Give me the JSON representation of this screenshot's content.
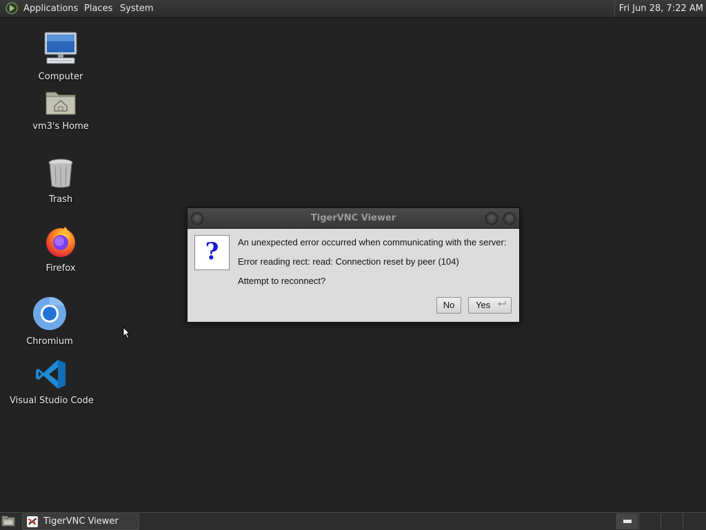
{
  "top_panel": {
    "menus": [
      "Applications",
      "Places",
      "System"
    ],
    "clock": "Fri Jun 28,  7:22 AM"
  },
  "desktop_icons": [
    {
      "label": "Computer",
      "icon": "computer-icon"
    },
    {
      "label": "vm3's Home",
      "icon": "home-folder-icon"
    },
    {
      "label": "Trash",
      "icon": "trash-icon"
    },
    {
      "label": "Firefox",
      "icon": "firefox-icon"
    },
    {
      "label": "Chromium",
      "icon": "chromium-icon"
    },
    {
      "label": "Visual Studio Code",
      "icon": "vscode-icon"
    }
  ],
  "dialog": {
    "title": "TigerVNC Viewer",
    "icon_glyph": "?",
    "lines": [
      "An unexpected error occurred when communicating with the server:",
      "Error reading rect: read: Connection reset by peer (104)",
      "Attempt to reconnect?"
    ],
    "buttons": {
      "no": "No",
      "yes": "Yes"
    }
  },
  "taskbar": {
    "window_button": "TigerVNC Viewer"
  }
}
